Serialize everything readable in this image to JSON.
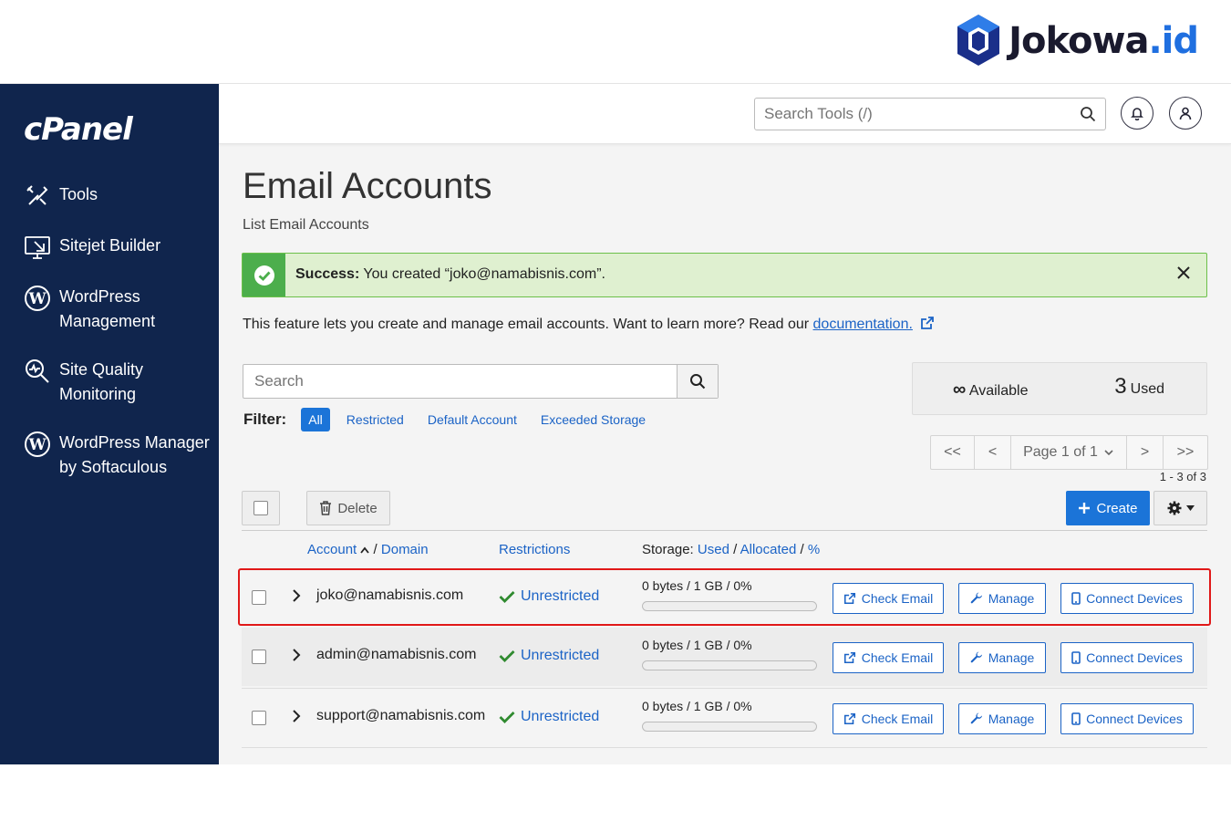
{
  "watermark": {
    "name": "Jokowa",
    "tld": ".id"
  },
  "sidebar": {
    "brand": "cPanel",
    "items": [
      {
        "label": "Tools",
        "icon": "tools-icon"
      },
      {
        "label": "Sitejet Builder",
        "icon": "sitejet-icon"
      },
      {
        "label": "WordPress Management",
        "icon": "wordpress-icon"
      },
      {
        "label": "Site Quality Monitoring",
        "icon": "site-quality-icon"
      },
      {
        "label": "WordPress Manager by Softaculous",
        "icon": "wordpress-icon"
      }
    ]
  },
  "header": {
    "search_placeholder": "Search Tools (/)"
  },
  "page": {
    "title": "Email Accounts",
    "subtitle": "List Email Accounts"
  },
  "alert": {
    "strong": "Success:",
    "message": " You created “joko@namabisnis.com”."
  },
  "description": {
    "text": "This feature lets you create and manage email accounts. Want to learn more? Read our ",
    "link": "documentation."
  },
  "search": {
    "placeholder": "Search"
  },
  "stats": {
    "available_symbol": "∞",
    "available_label": "Available",
    "used_count": "3",
    "used_label": "Used"
  },
  "filter": {
    "label": "Filter:",
    "options": [
      "All",
      "Restricted",
      "Default Account",
      "Exceeded Storage"
    ],
    "active": "All"
  },
  "pager": {
    "first": "<<",
    "prev": "<",
    "page_label": "Page 1 of 1",
    "next": ">",
    "last": ">>",
    "range": "1 - 3 of 3"
  },
  "toolbar": {
    "delete_label": "Delete",
    "create_label": "Create"
  },
  "table": {
    "headers": {
      "account": "Account",
      "separator": "/",
      "domain": "Domain",
      "restrictions": "Restrictions",
      "storage_prefix": "Storage:",
      "used": "Used",
      "allocated": "Allocated",
      "percent": "%"
    },
    "rows": [
      {
        "account": "joko@namabisnis.com",
        "restriction": "Unrestricted",
        "storage": "0 bytes / 1 GB / 0%",
        "usage_pct": 0
      },
      {
        "account": "admin@namabisnis.com",
        "restriction": "Unrestricted",
        "storage": "0 bytes / 1 GB / 0%",
        "usage_pct": 0
      },
      {
        "account": "support@namabisnis.com",
        "restriction": "Unrestricted",
        "storage": "0 bytes / 1 GB / 0%",
        "usage_pct": 0
      }
    ],
    "actions": {
      "check": "Check Email",
      "manage": "Manage",
      "connect": "Connect Devices"
    }
  },
  "colors": {
    "sidebar": "#10254d",
    "accent": "#1b74d8",
    "success": "#4cae4c",
    "highlight": "#e01818"
  }
}
